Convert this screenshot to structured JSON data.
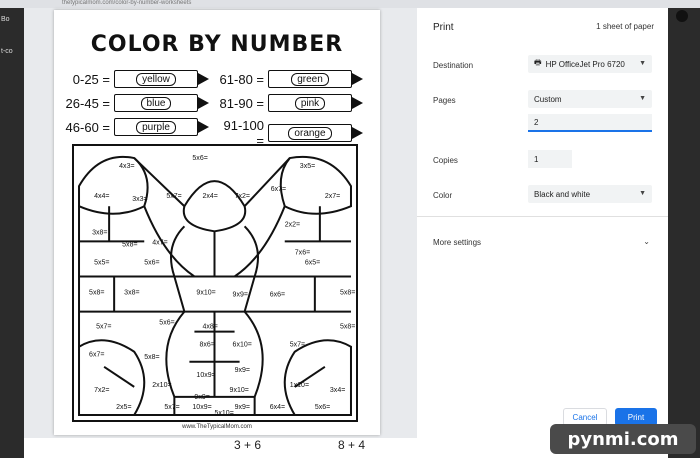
{
  "browser": {
    "url": "thetypicalmom.com/color-by-number-worksheets",
    "tab_labels": [
      "Bo",
      "t-co"
    ]
  },
  "sheet": {
    "title": "COLOR BY NUMBER",
    "legend": [
      {
        "range": "0-25 =",
        "color": "yellow"
      },
      {
        "range": "61-80 =",
        "color": "green"
      },
      {
        "range": "26-45 =",
        "color": "blue"
      },
      {
        "range": "81-90 =",
        "color": "pink"
      },
      {
        "range": "46-60 =",
        "color": "purple"
      },
      {
        "range": "91-100 =",
        "color": "orange"
      }
    ],
    "cells": [
      "4x3=",
      "5x6=",
      "3x5=",
      "4x4=",
      "3x3=",
      "5x7=",
      "2x4=",
      "7x2=",
      "6x7=",
      "2x7=",
      "3x8=",
      "5x8=",
      "4x7=",
      "2x2=",
      "7x6=",
      "5x5=",
      "5x6=",
      "6x5=",
      "3x8=",
      "5x8=",
      "5x8=",
      "9x10=",
      "9x9=",
      "6x6=",
      "5x7=",
      "5x6=",
      "4x8=",
      "5x8=",
      "6x7=",
      "8x6=",
      "6x10=",
      "5x7=",
      "5x8=",
      "2x10=",
      "10x9=",
      "9x9=",
      "1x10=",
      "7x2=",
      "9x9=",
      "9x10=",
      "3x4=",
      "2x5=",
      "10x9=",
      "9x9=",
      "6x4=",
      "5x7=",
      "5x10=",
      "5x6="
    ],
    "footer": "www.TheTypicalMom.com"
  },
  "print_panel": {
    "title": "Print",
    "sheet_count": "1 sheet of paper",
    "destination_label": "Destination",
    "destination_value": "HP OfficeJet Pro 6720",
    "pages_label": "Pages",
    "pages_value": "Custom",
    "pages_input": "2",
    "copies_label": "Copies",
    "copies_value": "1",
    "color_label": "Color",
    "color_value": "Black and white",
    "more_settings": "More settings",
    "cancel_label": "Cancel",
    "print_label": "Print"
  },
  "bottom_strip": {
    "left_text": "3 + 6",
    "right_text": "8 + 4"
  },
  "watermark": "pynmi.com",
  "icons": [
    "printer-icon",
    "chevron-down-icon"
  ],
  "colors": {
    "accent": "#1a73e8",
    "panel_bg": "#ffffff",
    "preview_bg": "#e8eaed"
  }
}
